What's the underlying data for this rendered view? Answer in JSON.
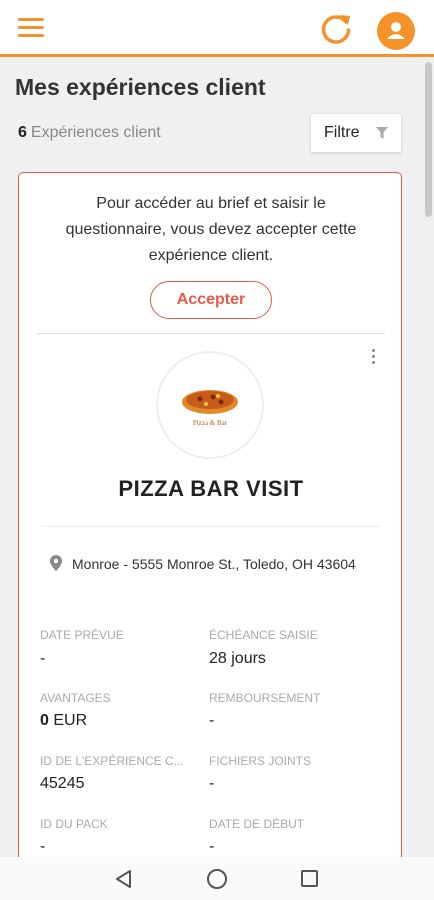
{
  "header": {
    "menu_icon": "hamburger-menu-icon",
    "refresh_icon": "refresh-icon",
    "profile_icon": "user-avatar-icon",
    "accent_color": "#f5922a"
  },
  "page": {
    "title": "Mes expériences client",
    "count": "6",
    "count_label": "Expériences client",
    "filter_label": "Filtre",
    "filter_icon": "funnel-icon"
  },
  "card": {
    "notice": "Pour accéder au brief et saisir le questionnaire, vous devez accepter cette expérience client.",
    "accept_label": "Accepter",
    "accent_color": "#e8594a",
    "logo_caption": "Pizza & Bar",
    "title": "PIZZA BAR VISIT",
    "address": "Monroe - 5555 Monroe St., Toledo, OH 43604",
    "fields": {
      "date_prevue": {
        "label": "DATE PRÉVUE",
        "value": "-"
      },
      "echeance": {
        "label": "ÉCHÉANCE SAISIE",
        "value": "28 jours"
      },
      "avantages": {
        "label": "AVANTAGES",
        "amount": "0",
        "currency": "EUR"
      },
      "remboursement": {
        "label": "REMBOURSEMENT",
        "value": "-"
      },
      "id_experience": {
        "label": "ID DE L'EXPÉRIENCE C...",
        "value": "45245"
      },
      "fichiers": {
        "label": "FICHIERS JOINTS",
        "value": "-"
      },
      "id_pack": {
        "label": "ID DU PACK",
        "value": "-"
      },
      "date_debut": {
        "label": "DATE DE DÉBUT",
        "value": "-"
      }
    }
  },
  "navbar": {
    "back_icon": "back-triangle-icon",
    "home_icon": "home-circle-icon",
    "recent_icon": "recent-apps-icon"
  }
}
